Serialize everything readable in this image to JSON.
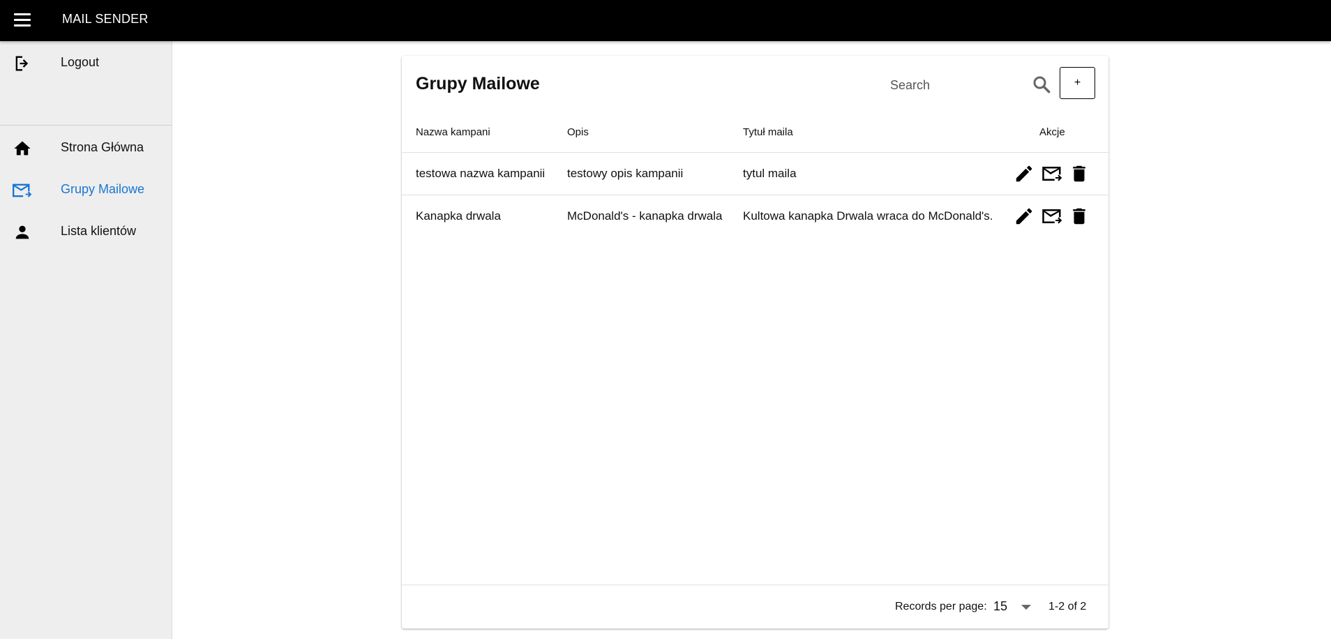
{
  "app": {
    "title": "MAIL SENDER",
    "menu_icon": "hamburger-menu-icon"
  },
  "sidebar": {
    "items": [
      {
        "label": "Logout",
        "icon": "logout-icon",
        "active": false
      },
      {
        "label": "Strona Główna",
        "icon": "home-icon",
        "active": false
      },
      {
        "label": "Grupy Mailowe",
        "icon": "mail-forward-icon",
        "active": true
      },
      {
        "label": "Lista klientów",
        "icon": "person-icon",
        "active": false
      }
    ]
  },
  "main": {
    "title": "Grupy Mailowe",
    "search": {
      "placeholder": "Search",
      "value": ""
    },
    "add_label": "+",
    "table": {
      "columns": [
        "Nazwa kampani",
        "Opis",
        "Tytuł maila",
        "Akcje"
      ],
      "rows": [
        {
          "name": "testowa nazwa kampanii",
          "description": "testowy opis kampanii",
          "subject": "tytul maila"
        },
        {
          "name": "Kanapka drwala",
          "description": "McDonald's - kanapka drwala",
          "subject": "Kultowa kanapka Drwala wraca do McDonald's."
        }
      ],
      "row_actions": [
        "edit-icon",
        "send-mail-icon",
        "delete-icon"
      ]
    },
    "pagination": {
      "records_per_page_label": "Records per page:",
      "records_per_page": "15",
      "range": "1-2 of 2"
    }
  },
  "colors": {
    "appbar": "#000000",
    "sidebar": "#eeeeee",
    "active": "#1976d2"
  }
}
